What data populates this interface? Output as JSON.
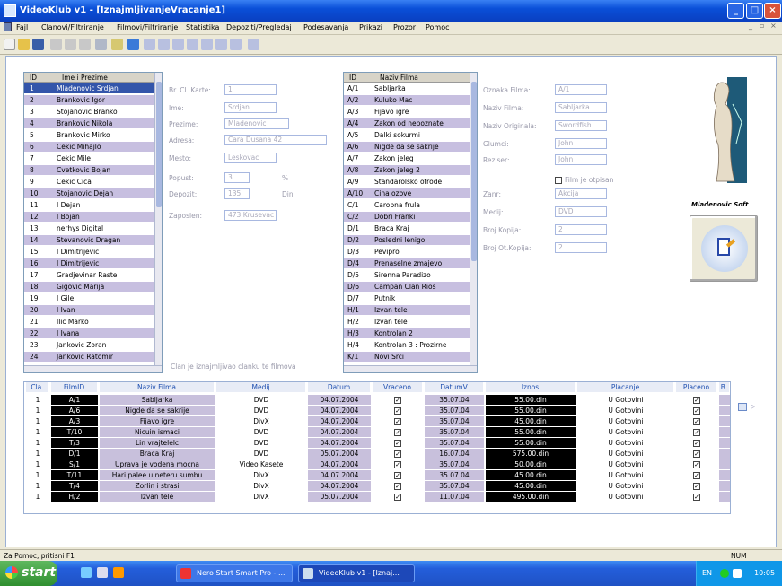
{
  "window": {
    "title": "VideoKlub v1 - [IznajmljivanjeVracanje1]"
  },
  "menu": [
    "Fajl",
    "Clanovi/Filtriranje",
    "Filmovi/Filtriranje",
    "Statistika",
    "Depoziti/Pregledaj",
    "Podesavanja",
    "Prikazi",
    "Prozor",
    "Pomoc"
  ],
  "members": {
    "headers": [
      "ID",
      "Ime i Prezime"
    ],
    "rows": [
      [
        "1",
        "Mladenovic Srdjan"
      ],
      [
        "2",
        "Brankovic Igor"
      ],
      [
        "3",
        "Stojanovic Branko"
      ],
      [
        "4",
        "Brankovic Nikola"
      ],
      [
        "5",
        "Brankovic Mirko"
      ],
      [
        "6",
        "Cekic Mihajlo"
      ],
      [
        "7",
        "Cekic Mile"
      ],
      [
        "8",
        "Cvetkovic Bojan"
      ],
      [
        "9",
        "Cekic Cica"
      ],
      [
        "10",
        "Stojanovic Dejan"
      ],
      [
        "11",
        "I Dejan"
      ],
      [
        "12",
        "I Bojan"
      ],
      [
        "13",
        "nerhys Digital"
      ],
      [
        "14",
        "Stevanovic Dragan"
      ],
      [
        "15",
        "I Dimitrijevic"
      ],
      [
        "16",
        "I Dimitrijevic"
      ],
      [
        "17",
        "Gradjevinar Raste"
      ],
      [
        "18",
        "Gigovic Marija"
      ],
      [
        "19",
        "I Gile"
      ],
      [
        "20",
        "I Ivan"
      ],
      [
        "21",
        "Ilic Marko"
      ],
      [
        "22",
        "I Ivana"
      ],
      [
        "23",
        "Jankovic Zoran"
      ],
      [
        "24",
        "Jankovic Ratomir"
      ]
    ]
  },
  "member_form": {
    "labels": [
      "Br. Cl. Karte:",
      "Ime:",
      "Prezime:",
      "Adresa:",
      "Mesto:",
      "Popust:",
      "Depozit:",
      "Zaposlen:"
    ],
    "values": [
      "1",
      "Srdjan",
      "Mladenovic",
      "Cara Dusana 42",
      "Leskovac",
      "3",
      "135",
      "473 Krusevac"
    ],
    "popust_unit": "%",
    "depozit_unit": "Din"
  },
  "member_hint": "Clan je iznajmljivao clanku te filmova",
  "films": {
    "headers": [
      "ID",
      "Naziv Filma"
    ],
    "rows": [
      [
        "A/1",
        "Sabljarka"
      ],
      [
        "A/2",
        "Kuluko Mac"
      ],
      [
        "A/3",
        "Fijavo igre"
      ],
      [
        "A/4",
        "Zakon od nepoznate"
      ],
      [
        "A/5",
        "Dalki sokurmi"
      ],
      [
        "A/6",
        "Nigde da se sakrije"
      ],
      [
        "A/7",
        "Zakon jeleg"
      ],
      [
        "A/8",
        "Zakon jeleg 2"
      ],
      [
        "A/9",
        "Standarolsko ofrode"
      ],
      [
        "A/10",
        "Cina ozove"
      ],
      [
        "C/1",
        "Carobna frula"
      ],
      [
        "C/2",
        "Dobri Franki"
      ],
      [
        "D/1",
        "Braca Kraj"
      ],
      [
        "D/2",
        "Posledni lenigo"
      ],
      [
        "D/3",
        "Pevipro"
      ],
      [
        "D/4",
        "Prenaselne zmajevo"
      ],
      [
        "D/5",
        "Sirenna Paradizo"
      ],
      [
        "D/6",
        "Campan Clan Rios"
      ],
      [
        "D/7",
        "Putnik"
      ],
      [
        "H/1",
        "Izvan tele"
      ],
      [
        "H/2",
        "Izvan tele"
      ],
      [
        "H/3",
        "Kontrolan 2"
      ],
      [
        "H/4",
        "Kontrolan 3 : Prozirne"
      ],
      [
        "K/1",
        "Novi Srci"
      ]
    ]
  },
  "film_form": {
    "labels": [
      "Oznaka Filma:",
      "Naziv Filma:",
      "Naziv Originala:",
      "Glumci:",
      "Reziser:"
    ],
    "values": [
      "A/1",
      "Sabljarka",
      "Swordfish",
      "John",
      "John"
    ],
    "checkbox_label": "Film je otpisan",
    "labels2": [
      "Zanr:",
      "Medij:",
      "Broj Kopija:",
      "Broj Ot.Kopija:"
    ],
    "values2": [
      "Akcija",
      "DVD",
      "2",
      "2"
    ]
  },
  "logo_text": "Mladenovic Soft",
  "grid": {
    "headers": [
      "Cla.",
      "FilmID",
      "Naziv Filma",
      "Medij",
      "Datum",
      "Vraceno",
      "DatumV",
      "Iznos",
      "Placanje",
      "Placeno",
      "B."
    ],
    "rows": [
      [
        "1",
        "A/1",
        "Sabljarka",
        "DVD",
        "04.07.2004",
        "35.07.04",
        "55.00.din",
        "U Gotovini"
      ],
      [
        "1",
        "A/6",
        "Nigde da se sakrije",
        "DVD",
        "04.07.2004",
        "35.07.04",
        "55.00.din",
        "U Gotovini"
      ],
      [
        "1",
        "A/3",
        "Fijavo igre",
        "DivX",
        "04.07.2004",
        "35.07.04",
        "45.00.din",
        "U Gotovini"
      ],
      [
        "1",
        "T/10",
        "Nicuin ismaci",
        "DVD",
        "04.07.2004",
        "35.07.04",
        "55.00.din",
        "U Gotovini"
      ],
      [
        "1",
        "T/3",
        "Lin vrajtelelc",
        "DVD",
        "04.07.2004",
        "35.07.04",
        "55.00.din",
        "U Gotovini"
      ],
      [
        "1",
        "D/1",
        "Braca Kraj",
        "DVD",
        "05.07.2004",
        "16.07.04",
        "575.00.din",
        "U Gotovini"
      ],
      [
        "1",
        "S/1",
        "Uprava je vodena mocna",
        "Video Kasete",
        "04.07.2004",
        "35.07.04",
        "50.00.din",
        "U Gotovini"
      ],
      [
        "1",
        "T/11",
        "Hari palee u neteru sumbu",
        "DivX",
        "04.07.2004",
        "35.07.04",
        "45.00.din",
        "U Gotovini"
      ],
      [
        "1",
        "T/4",
        "Zorlin i strasi",
        "DivX",
        "04.07.2004",
        "35.07.04",
        "45.00.din",
        "U Gotovini"
      ],
      [
        "1",
        "H/2",
        "Izvan tele",
        "DivX",
        "05.07.2004",
        "11.07.04",
        "495.00.din",
        "U Gotovini"
      ]
    ]
  },
  "status": {
    "left": "Za Pomoc, pritisni F1",
    "right": "NUM"
  },
  "taskbar": {
    "start": "start",
    "tasks": [
      "Nero Start Smart Pro - ...",
      "VideoKlub v1 - [Iznaj..."
    ],
    "tray_lang": "EN",
    "clock": "10:05"
  }
}
